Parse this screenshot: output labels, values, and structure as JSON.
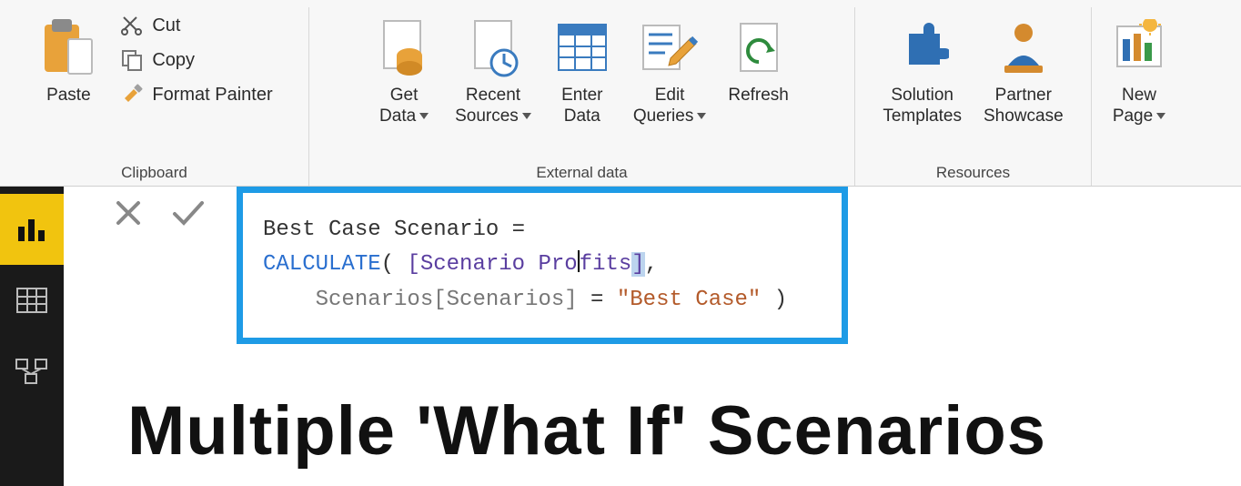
{
  "ribbon": {
    "groups": {
      "clipboard": {
        "label": "Clipboard",
        "paste": "Paste",
        "cut": "Cut",
        "copy": "Copy",
        "format_painter": "Format Painter"
      },
      "external_data": {
        "label": "External data",
        "get_data": "Get\nData",
        "recent_sources": "Recent\nSources",
        "enter_data": "Enter\nData",
        "edit_queries": "Edit\nQueries",
        "refresh": "Refresh"
      },
      "resources": {
        "label": "Resources",
        "solution_templates": "Solution\nTemplates",
        "partner_showcase": "Partner\nShowcase"
      },
      "insert": {
        "new_page": "New\nPage"
      }
    }
  },
  "leftnav": {
    "items": [
      "report-view",
      "data-view",
      "model-view"
    ]
  },
  "formula": {
    "line1_plain": "Best Case Scenario = ",
    "calc_kw": "CALCULATE",
    "paren_open": "( ",
    "measure_open": "[Scenario Pr",
    "measure_mid": "o",
    "measure_end": "fits",
    "measure_close_bracket": "]",
    "comma": ",",
    "indent": "    ",
    "table_col": "Scenarios[Scenarios]",
    "eq": " = ",
    "strlit": "\"Best Case\"",
    "close": " )"
  },
  "canvas": {
    "title": "Multiple 'What If' Scenarios"
  }
}
